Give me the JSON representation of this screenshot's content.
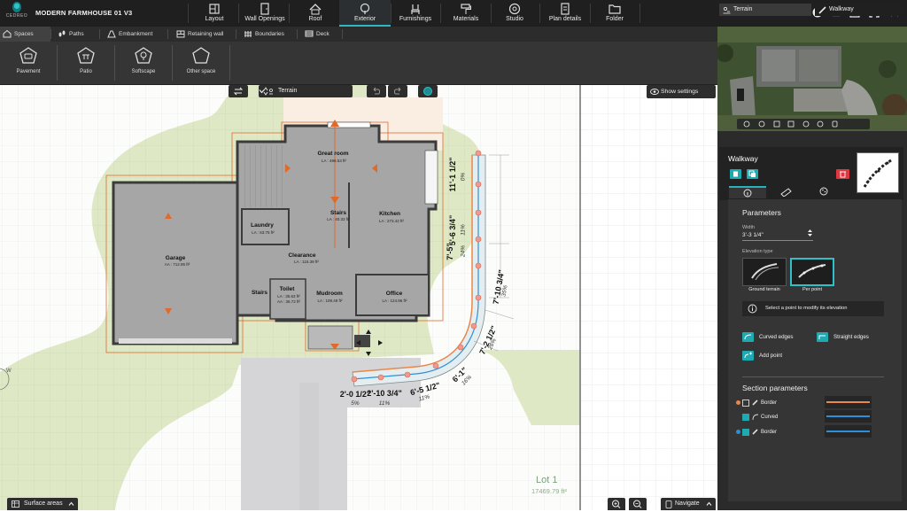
{
  "app": {
    "logo_text": "CEDREO",
    "project_title": "MODERN FARMHOUSE 01 V3"
  },
  "top_tabs": [
    {
      "label": "Layout",
      "icon": "layout-icon"
    },
    {
      "label": "Wall Openings",
      "icon": "door-icon"
    },
    {
      "label": "Roof",
      "icon": "roof-icon"
    },
    {
      "label": "Exterior",
      "icon": "tree-icon",
      "active": true
    },
    {
      "label": "Furnishings",
      "icon": "chair-icon"
    },
    {
      "label": "Materials",
      "icon": "paint-roller-icon"
    },
    {
      "label": "Studio",
      "icon": "camera-icon"
    },
    {
      "label": "Plan details",
      "icon": "plan-details-icon"
    },
    {
      "label": "Folder",
      "icon": "folder-icon"
    }
  ],
  "top_right_icons": [
    "help-icon",
    "chat-icon",
    "save-icon",
    "fullscreen-icon"
  ],
  "sub_tabs": [
    {
      "label": "Spaces",
      "active": true
    },
    {
      "label": "Paths"
    },
    {
      "label": "Embankment"
    },
    {
      "label": "Retaining wall"
    },
    {
      "label": "Boundaries"
    },
    {
      "label": "Deck"
    }
  ],
  "spaces": [
    {
      "label": "Pavement"
    },
    {
      "label": "Patio"
    },
    {
      "label": "Softscape"
    },
    {
      "label": "Other space"
    }
  ],
  "canvas_controls": {
    "level_select": "Terrain",
    "show_settings": "Show settings"
  },
  "rooms": [
    {
      "name": "Great room",
      "area": "LA : 496.53 ft²"
    },
    {
      "name": "Stairs",
      "area": "LA : 40.33 ft²"
    },
    {
      "name": "Kitchen",
      "area": "LA : 273.42 ft²"
    },
    {
      "name": "Laundry",
      "area": "LA : 63.75 ft²"
    },
    {
      "name": "Garage",
      "area": "AA : 712.95 ft²"
    },
    {
      "name": "Clearance",
      "area": "LA : 115.39 ft²"
    },
    {
      "name": "Stairs",
      "area": ""
    },
    {
      "name": "Toilet",
      "area": "LA : 35.63 ft²"
    },
    {
      "name": "",
      "area": "AA : 36.72 ft²"
    },
    {
      "name": "Mudroom",
      "area": "LA : 109.49 ft²"
    },
    {
      "name": "Office",
      "area": "LA : 124.96 ft²"
    }
  ],
  "dimensions": {
    "d1": "11'-1 1/2\"",
    "d1s": "0%",
    "d2": "5'-6 3/4\"",
    "d2s": "11%",
    "d3": "7'-5\"",
    "d3s": "24%",
    "d4": "7'-10 3/4\"",
    "d4s": "35%",
    "d5": "7'-2 1/2\"",
    "d5s": "26%",
    "d6": "6'-1\"",
    "d6s": "16%",
    "d7": "6'-5 1/2\"",
    "d7s": "11%",
    "d8": "2'-10 3/4\"",
    "d8s": "11%",
    "d9": "2'-0 1/2\"",
    "d9s": "5%"
  },
  "lot": {
    "name": "Lot 1",
    "area": "17469.79 ft²"
  },
  "bottom_bar": {
    "surface_areas": "Surface areas",
    "navigate": "Navigate"
  },
  "panel": {
    "tab_terrain": "Terrain",
    "tab_walkway": "Walkway",
    "title": "Walkway",
    "parameters_title": "Parameters",
    "width_label": "Width",
    "width_value": "3'-3 1/4\"",
    "elevation_label": "Elevation type",
    "elevation_options": [
      "Ground terrain",
      "Per point"
    ],
    "info_text": "Select a point to modify its elevation",
    "curved_edges": "Curved edges",
    "straight_edges": "Straight edges",
    "add_point": "Add point",
    "section_title": "Section parameters",
    "section_rows": [
      {
        "label": "Border",
        "color": "#e8884a"
      },
      {
        "label": "Curved",
        "color": "#2e8fd9"
      },
      {
        "label": "Border",
        "color": "#2e8fd9"
      }
    ]
  },
  "colors": {
    "accent": "#2fb8c0",
    "delete": "#e0373f",
    "construction_line": "#e06a2c",
    "lawn": "#dfe8c6",
    "room_fill": "#a9a9a9"
  }
}
